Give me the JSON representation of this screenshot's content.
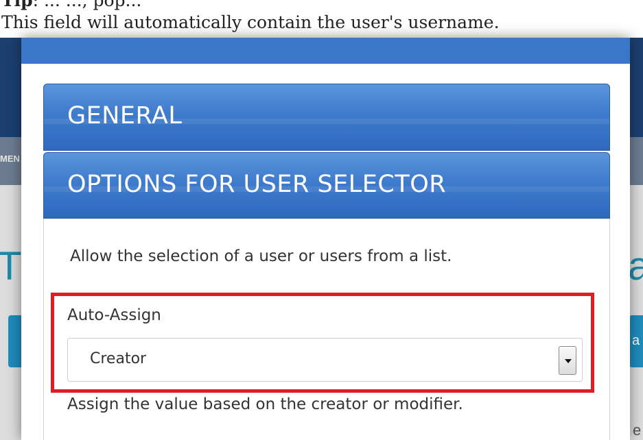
{
  "doc": {
    "cut_line_bold": "Tip",
    "cut_line_rest": ": ... ..., pop...",
    "caption": "This field will automatically contain the user's username."
  },
  "background": {
    "nav_fragment": "MEN",
    "left_char": "T",
    "right_char": "a",
    "right_btn_char": "a",
    "bottom_fragment": "e"
  },
  "modal": {
    "panels": [
      {
        "title": "GENERAL"
      },
      {
        "title": "OPTIONS FOR USER SELECTOR"
      }
    ],
    "description": "Allow the selection of a user or users from a list.",
    "field": {
      "label": "Auto-Assign",
      "selected": "Creator",
      "help": "Assign the value based on the creator or modifier."
    }
  },
  "colors": {
    "panel_blue": "#3f7bcc",
    "highlight_red": "#e01c24"
  }
}
